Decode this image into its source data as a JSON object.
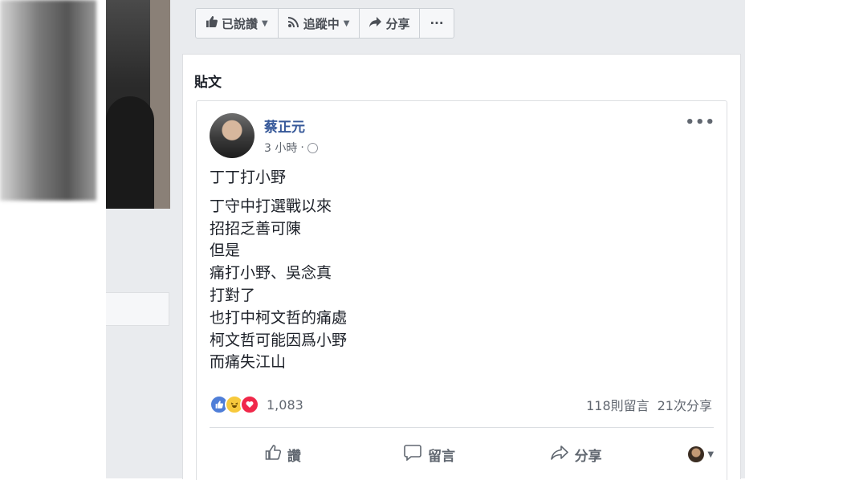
{
  "action_bar": {
    "liked_label": "已說讚",
    "following_label": "追蹤中",
    "share_label": "分享",
    "more_label": "···"
  },
  "panel": {
    "title": "貼文"
  },
  "post": {
    "author": "蔡正元",
    "time": "3 小時",
    "separator": "·",
    "more_label": "•••",
    "headline": "丁丁打小野",
    "lines": [
      "丁守中打選戰以來",
      "招招乏善可陳",
      "但是",
      "痛打小野、吳念真",
      "打對了",
      "也打中柯文哲的痛處",
      "柯文哲可能因爲小野",
      "而痛失江山"
    ],
    "reaction_count": "1,083",
    "comments_count": "118則留言",
    "shares_count": "21次分享",
    "like_btn": "讚",
    "comment_btn": "留言",
    "share_btn": "分享"
  },
  "colors": {
    "link_blue": "#365899",
    "like_blue": "#4f7ed8",
    "love_red": "#f0284a",
    "haha_yellow": "#f7c93c",
    "page_bg": "#e9ebee"
  },
  "icons": [
    "thumbs-up-icon",
    "rss-icon",
    "share-arrow-icon",
    "globe-icon",
    "comment-icon",
    "caret-down-icon"
  ]
}
